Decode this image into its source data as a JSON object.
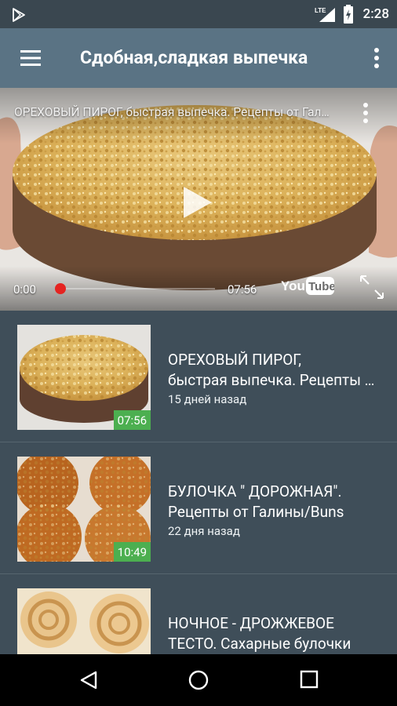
{
  "status_bar": {
    "network": "LTE",
    "time": "2:28",
    "icons": [
      "play-store-icon",
      "signal-icon",
      "battery-icon"
    ]
  },
  "app_bar": {
    "title": "Сдобная,сладкая выпечка",
    "icons": [
      "menu-icon",
      "overflow-menu-icon"
    ]
  },
  "player": {
    "title": "ОРЕХОВЫЙ ПИРОГ, быстрая выпечка. Рецепты от Галины",
    "time_current": "0:00",
    "time_total": "07:56",
    "logo_text": "YouTube",
    "progress": 0,
    "icons": [
      "more-icon",
      "play-icon",
      "fullscreen-icon"
    ]
  },
  "videos": [
    {
      "title_line1": "ОРЕХОВЫЙ ПИРОГ,",
      "title_line2": "быстрая выпечка. Рецепты от Галины",
      "date": "15 дней назад",
      "duration": "07:56"
    },
    {
      "title_line1": "БУЛОЧКА \" ДОРОЖНАЯ\".",
      "title_line2": "Рецепты от Галины/Buns",
      "date": "22 дня назад",
      "duration": "10:49"
    },
    {
      "title_line1": "НОЧНОЕ - ДРОЖЖЕВОЕ",
      "title_line2": "ТЕСТО. Сахарные булочки",
      "date": "",
      "duration": ""
    }
  ],
  "nav_bar": {
    "icons": [
      "back-icon",
      "home-icon",
      "recents-icon"
    ]
  },
  "colors": {
    "app_bar": "#5a7384",
    "background": "#3f4e59",
    "duration_badge": "#4caf50",
    "progress_dot": "#e52421"
  }
}
